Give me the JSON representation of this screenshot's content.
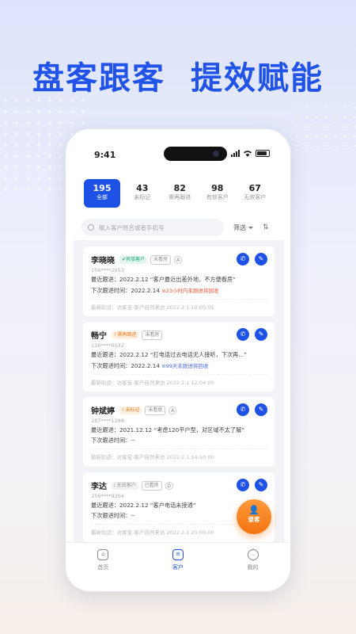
{
  "headline": {
    "left": "盘客跟客",
    "right": "提效赋能"
  },
  "status": {
    "time": "9:41"
  },
  "tabs": [
    {
      "count": "195",
      "label": "全部"
    },
    {
      "count": "43",
      "label": "未标记"
    },
    {
      "count": "82",
      "label": "需再跟进"
    },
    {
      "count": "98",
      "label": "有效客户"
    },
    {
      "count": "67",
      "label": "无效客户"
    }
  ],
  "search": {
    "placeholder": "输入客户姓名或者手机号",
    "filter_label": "筛选",
    "sort_icon": "⇅"
  },
  "cards": [
    {
      "name": "李晓晓",
      "badge": "有效客户",
      "badge_icon": "✔",
      "seen": "未看房",
      "grade": "A",
      "phone": "156****2053",
      "last": "最近跟进：2022.2.12 “客户最近出差外地，不方便看房”",
      "next": "下次跟进时间：2022.2.14",
      "note": "23小时内未跟进将回收",
      "track": "最新轨迹：访客宝-客户自然来访   2022.2.1  10:00:05"
    },
    {
      "name": "畅宁",
      "badge": "需再跟进",
      "badge_icon": "!",
      "seen": "未看房",
      "grade": "",
      "phone": "138****0032",
      "last": "最近跟进：2022.2.12 “打电话过去电话无人接听，下次再...”",
      "next": "下次跟进时间：2022.2.14",
      "note": "99天未跟进将回收",
      "track": "最新轨迹：访客宝-客户自然来访   2022.2.1   12:04:00"
    },
    {
      "name": "钟斌婷",
      "badge": "未标记",
      "badge_icon": "!",
      "seen": "未看房",
      "grade": "A",
      "phone": "187****1298",
      "last": "最近跟进：2021.12.12 “考虑120平户型，对区域不太了解”",
      "next": "下次跟进时间：--",
      "note": "",
      "track": "最新轨迹：访客宝-客户自然来访   2022.2.1   14:50:00"
    },
    {
      "name": "李达",
      "badge": "无效客户",
      "badge_icon": "i",
      "seen": "已看房",
      "grade": "D",
      "phone": "156****9304",
      "last": "最近跟进：2022.2.12 “客户电话未接通”",
      "next": "下次跟进时间：--",
      "note": "",
      "track": "最新轨迹：访客宝-客户自然来访   2022.2.1   20:00:00"
    }
  ],
  "fab": {
    "label": "录客",
    "icon": "person-add-icon"
  },
  "nav": [
    {
      "label": "首页",
      "icon": "home-icon"
    },
    {
      "label": "客户",
      "icon": "customer-icon"
    },
    {
      "label": "我的",
      "icon": "profile-icon"
    }
  ]
}
